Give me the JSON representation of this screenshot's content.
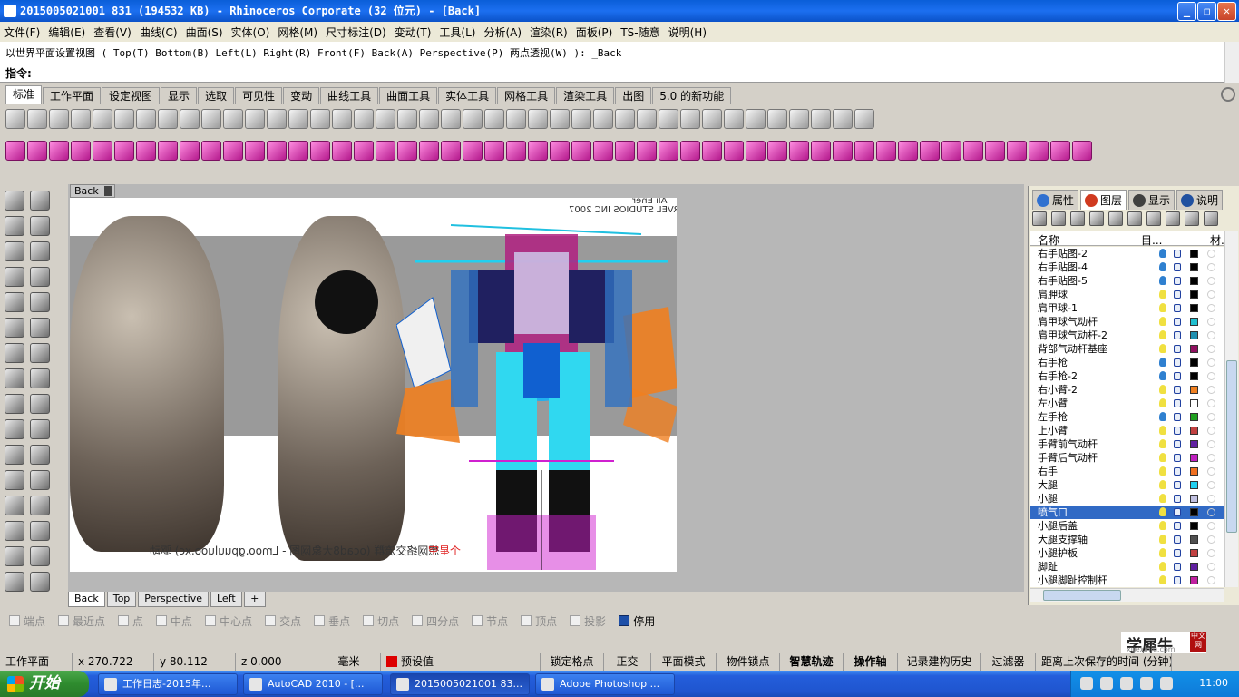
{
  "window": {
    "title": "2015005021001 831 (194532 KB) - Rhinoceros Corporate (32 位元) - [Back]",
    "buttons": [
      "_",
      "❐",
      "✕"
    ]
  },
  "menu": [
    "文件(F)",
    "编辑(E)",
    "查看(V)",
    "曲线(C)",
    "曲面(S)",
    "实体(O)",
    "网格(M)",
    "尺寸标注(D)",
    "变动(T)",
    "工具(L)",
    "分析(A)",
    "渲染(R)",
    "面板(P)",
    "TS-随意",
    "说明(H)"
  ],
  "command": {
    "history": "以世界平面设置视图 ( Top(T)  Bottom(B)  Left(L)  Right(R)  Front(F)  Back(A)  Perspective(P)  两点透视(W) ): _Back",
    "label": "指令:"
  },
  "toolbar_tabs": [
    {
      "label": "标准",
      "active": true
    },
    {
      "label": "工作平面"
    },
    {
      "label": "设定视图"
    },
    {
      "label": "显示"
    },
    {
      "label": "选取"
    },
    {
      "label": "可见性"
    },
    {
      "label": "变动"
    },
    {
      "label": "曲线工具"
    },
    {
      "label": "曲面工具"
    },
    {
      "label": "实体工具"
    },
    {
      "label": "网格工具"
    },
    {
      "label": "渲染工具"
    },
    {
      "label": "出图"
    },
    {
      "label": "5.0 的新功能"
    }
  ],
  "viewport": {
    "title": "Back",
    "watermark_top_1": "Ali Ener",
    "watermark_top_2": "©MARVEL STUDIOS INC 2007",
    "watermark_bottom": "想网络交流群 (ocad8大象网图 - Lmoo.gpuuluoo.xc) 驱动",
    "watermark_bottom_red": "个星空"
  },
  "viewport_tabs": [
    {
      "label": "Back",
      "active": true
    },
    {
      "label": "Top"
    },
    {
      "label": "Perspective"
    },
    {
      "label": "Left"
    },
    {
      "label": "+"
    }
  ],
  "panel": {
    "tabs": [
      {
        "label": "属性",
        "color": "#3070d0"
      },
      {
        "label": "图层",
        "color": "#d03a20",
        "active": true
      },
      {
        "label": "显示",
        "color": "#404040"
      },
      {
        "label": "说明",
        "color": "#2050a0"
      }
    ],
    "headers": {
      "name": "名称",
      "current": "目...",
      "material": "材..."
    },
    "layers": [
      {
        "name": "右手贴图-2",
        "color": "#000000",
        "bulb": "blue"
      },
      {
        "name": "右手贴图-4",
        "color": "#000000",
        "bulb": "blue"
      },
      {
        "name": "右手贴图-5",
        "color": "#000000",
        "bulb": "blue"
      },
      {
        "name": "肩胛球",
        "color": "#000000",
        "bulb": "yellow"
      },
      {
        "name": "肩甲球-1",
        "color": "#000000",
        "bulb": "yellow"
      },
      {
        "name": "肩甲球气动杆",
        "color": "#20c0d0",
        "bulb": "yellow"
      },
      {
        "name": "肩甲球气动杆-2",
        "color": "#2090b0",
        "bulb": "yellow"
      },
      {
        "name": "背部气动杆基座",
        "color": "#901060",
        "bulb": "yellow"
      },
      {
        "name": "右手枪",
        "color": "#000000",
        "bulb": "blue"
      },
      {
        "name": "右手枪-2",
        "color": "#000000",
        "bulb": "blue"
      },
      {
        "name": "右小臂-2",
        "color": "#f08020",
        "bulb": "yellow"
      },
      {
        "name": "左小臂",
        "color": "#ffffff",
        "bulb": "yellow"
      },
      {
        "name": "左手枪",
        "color": "#20a020",
        "bulb": "blue"
      },
      {
        "name": "上小臂",
        "color": "#c04040",
        "bulb": "yellow"
      },
      {
        "name": "手臂前气动杆",
        "color": "#6020a0",
        "bulb": "yellow"
      },
      {
        "name": "手臂后气动杆",
        "color": "#c020c0",
        "bulb": "yellow"
      },
      {
        "name": "右手",
        "color": "#f07020",
        "bulb": "yellow"
      },
      {
        "name": "大腿",
        "color": "#20d0f0",
        "bulb": "yellow"
      },
      {
        "name": "小腿",
        "color": "#c0c0e0",
        "bulb": "yellow"
      },
      {
        "name": "喷气口",
        "color": "#000000",
        "bulb": "yellow",
        "selected": true
      },
      {
        "name": "小腿后盖",
        "color": "#000000",
        "bulb": "yellow"
      },
      {
        "name": "大腿支撑轴",
        "color": "#505050",
        "bulb": "yellow"
      },
      {
        "name": "小腿护板",
        "color": "#c04040",
        "bulb": "yellow"
      },
      {
        "name": "脚趾",
        "color": "#6020a0",
        "bulb": "yellow"
      },
      {
        "name": "小腿脚趾控制杆",
        "color": "#c020a0",
        "bulb": "yellow"
      }
    ]
  },
  "osnap": [
    {
      "label": "端点",
      "checked": false
    },
    {
      "label": "最近点",
      "checked": false
    },
    {
      "label": "点",
      "checked": false
    },
    {
      "label": "中点",
      "checked": false
    },
    {
      "label": "中心点",
      "checked": false
    },
    {
      "label": "交点",
      "checked": false
    },
    {
      "label": "垂点",
      "checked": false
    },
    {
      "label": "切点",
      "checked": false
    },
    {
      "label": "四分点",
      "checked": false
    },
    {
      "label": "节点",
      "checked": false
    },
    {
      "label": "顶点",
      "checked": false
    },
    {
      "label": "投影",
      "checked": false
    },
    {
      "label": "停用",
      "checked": true
    }
  ],
  "logo": {
    "main": "学犀牛",
    "sub": "xuexiniu.com",
    "badge": "中文网"
  },
  "status": {
    "cplane": "工作平面",
    "x": "x 270.722",
    "y": "y 80.112",
    "z": "z 0.000",
    "units": "毫米",
    "layer": "预设值",
    "buttons": [
      {
        "label": "锁定格点"
      },
      {
        "label": "正交"
      },
      {
        "label": "平面模式"
      },
      {
        "label": "物件锁点"
      },
      {
        "label": "智慧轨迹",
        "bold": true
      },
      {
        "label": "操作轴",
        "bold": true
      },
      {
        "label": "记录建构历史"
      },
      {
        "label": "过滤器"
      },
      {
        "label": "距离上次保存的时间 (分钟): 0"
      }
    ]
  },
  "taskbar": {
    "start": "开始",
    "tasks": [
      {
        "label": "工作日志-2015年..."
      },
      {
        "label": "AutoCAD 2010 - [..."
      },
      {
        "label": "2015005021001 83...",
        "active": true
      },
      {
        "label": "Adobe Photoshop ..."
      }
    ],
    "clock": "11:00"
  }
}
